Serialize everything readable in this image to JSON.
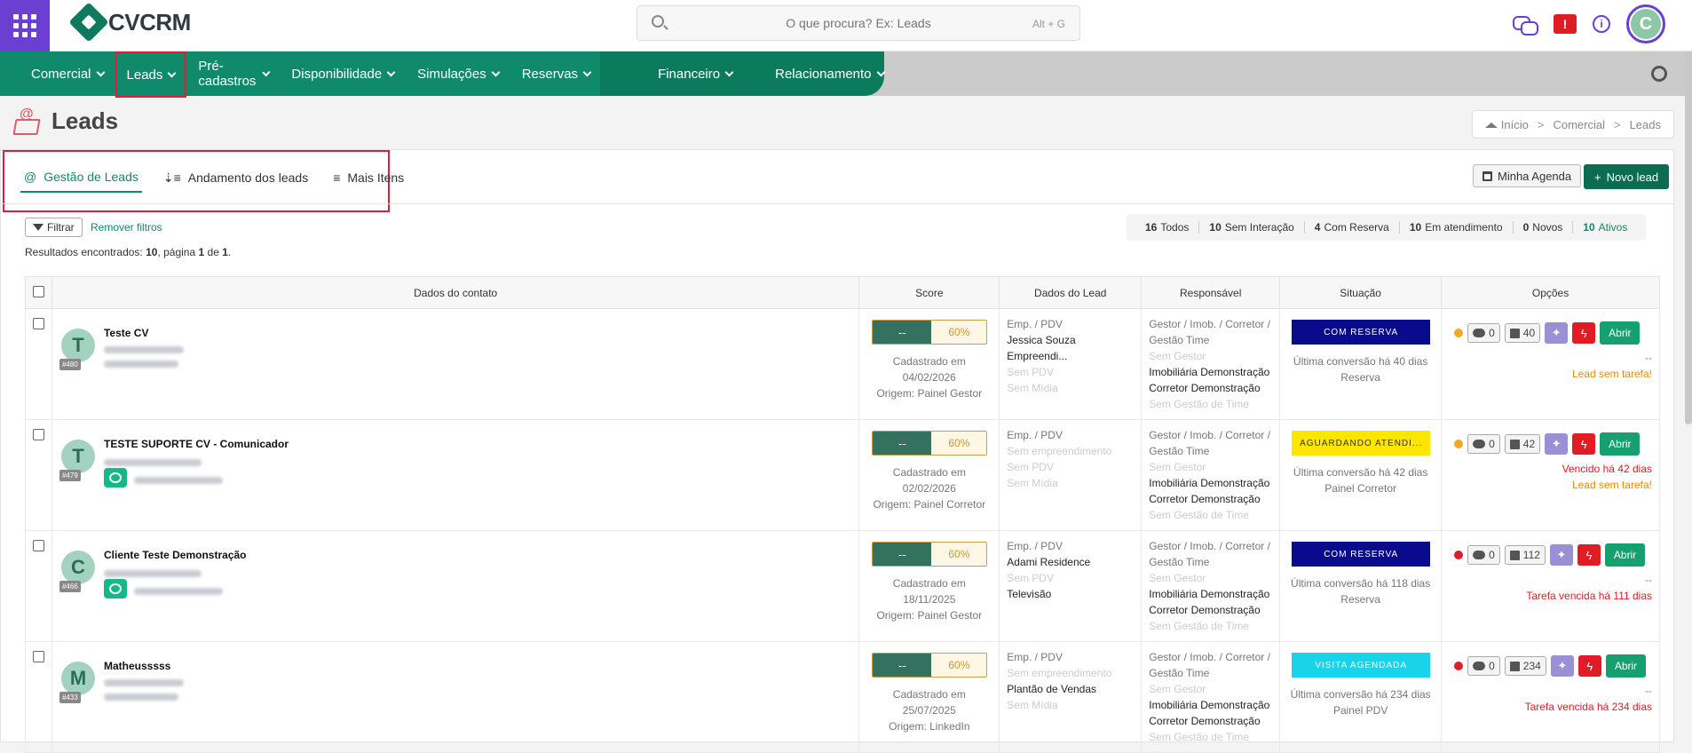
{
  "app": {
    "brand": "CVCRM"
  },
  "search": {
    "placeholder": "O que procura? Ex: Leads",
    "shortcut": "Alt + G"
  },
  "topbar": {
    "alert_glyph": "!",
    "info_glyph": "i",
    "user_initial": "C"
  },
  "nav": {
    "items": [
      "Comercial",
      "Leads",
      "Pré-cadastros",
      "Disponibilidade",
      "Simulações",
      "Reservas",
      "Financeiro",
      "Relacionamento"
    ]
  },
  "page": {
    "title": "Leads"
  },
  "breadcrumb": {
    "items": [
      "Início",
      "Comercial",
      "Leads"
    ],
    "sep": ">"
  },
  "tabs": {
    "items": [
      "Gestão de Leads",
      "Andamento dos leads",
      "Mais Itens"
    ]
  },
  "toolbar": {
    "agenda": "Minha Agenda",
    "novo": "Novo lead",
    "filtrar": "Filtrar",
    "remover": "Remover filtros"
  },
  "results": {
    "label": "Resultados encontrados:",
    "count": "10",
    "page_label": ", página",
    "page": "1",
    "of_label": "de",
    "total_pages": "1",
    "end": "."
  },
  "counters": [
    {
      "n": "16",
      "label": "Todos"
    },
    {
      "n": "10",
      "label": "Sem Interação"
    },
    {
      "n": "4",
      "label": "Com Reserva"
    },
    {
      "n": "10",
      "label": "Em atendimento"
    },
    {
      "n": "0",
      "label": "Novos"
    },
    {
      "n": "10",
      "label": "Ativos"
    }
  ],
  "table": {
    "headers": [
      "Dados do contato",
      "Score",
      "Dados do Lead",
      "Responsável",
      "Situação",
      "Opções"
    ],
    "abrir": "Abrir",
    "score_dash": "--",
    "rows": [
      {
        "initial": "T",
        "id": "#480",
        "name": "Teste CV",
        "chat": false,
        "score_pct": "60%",
        "score_value": 0.6,
        "cadastrado_label": "Cadastrado em",
        "cadastrado": "04/02/2026",
        "origem": "Origem: Painel Gestor",
        "lead": [
          "Emp. / PDV",
          "Jessica Souza Empreendi...",
          "Sem PDV",
          "Sem Mídia"
        ],
        "lead_style": [
          "gray",
          "dark",
          "faint",
          "faint"
        ],
        "resp": [
          "Gestor / Imob. / Corretor /",
          "Gestão Time",
          "Sem Gestor",
          "Imobiliária Demonstração",
          "Corretor Demonstração",
          "Sem Gestão de Time"
        ],
        "sit": "COM RESERVA",
        "sit_bg": "#0a0a8c",
        "sit_fg": "#ffffff",
        "sit_info": [
          "Última conversão há 40 dias",
          "Reserva"
        ],
        "dot": "#f5a623",
        "chats": "0",
        "tasks": "40",
        "notes": [
          "--",
          "Lead sem tarefa!"
        ],
        "notes_style": [
          "gray",
          "orange"
        ]
      },
      {
        "initial": "T",
        "id": "#479",
        "name": "TESTE SUPORTE CV - Comunicador",
        "chat": true,
        "score_pct": "60%",
        "score_value": 0.6,
        "cadastrado_label": "Cadastrado em",
        "cadastrado": "02/02/2026",
        "origem": "Origem: Painel Corretor",
        "lead": [
          "Emp. / PDV",
          "Sem empreendimento",
          "Sem PDV",
          "Sem Mídia"
        ],
        "lead_style": [
          "gray",
          "faint",
          "faint",
          "faint"
        ],
        "resp": [
          "Gestor / Imob. / Corretor /",
          "Gestão Time",
          "Sem Gestor",
          "Imobiliária Demonstração",
          "Corretor Demonstração",
          "Sem Gestão de Time"
        ],
        "sit": "AGUARDANDO ATENDI...",
        "sit_bg": "#ffe600",
        "sit_fg": "#333333",
        "sit_info": [
          "Última conversão há 42 dias",
          "Painel Corretor"
        ],
        "dot": "#f5a623",
        "chats": "0",
        "tasks": "42",
        "notes": [
          "Vencido há 42 dias",
          "Lead sem tarefa!"
        ],
        "notes_style": [
          "red",
          "orange"
        ]
      },
      {
        "initial": "C",
        "id": "#466",
        "name": "Cliente Teste Demonstração",
        "chat": true,
        "score_pct": "60%",
        "score_value": 0.6,
        "cadastrado_label": "Cadastrado em",
        "cadastrado": "18/11/2025",
        "origem": "Origem: Painel Gestor",
        "lead": [
          "Emp. / PDV",
          "Adami Residence",
          "Sem PDV",
          "Televisão"
        ],
        "lead_style": [
          "gray",
          "dark",
          "faint",
          "dark"
        ],
        "resp": [
          "Gestor / Imob. / Corretor /",
          "Gestão Time",
          "Sem Gestor",
          "Imobiliária Demonstração",
          "Corretor Demonstração",
          "Sem Gestão de Time"
        ],
        "sit": "COM RESERVA",
        "sit_bg": "#0a0a8c",
        "sit_fg": "#ffffff",
        "sit_info": [
          "Última conversão há 118 dias",
          "Reserva"
        ],
        "dot": "#e01c24",
        "chats": "0",
        "tasks": "112",
        "notes": [
          "--",
          "Tarefa vencida há 111 dias"
        ],
        "notes_style": [
          "gray",
          "red"
        ]
      },
      {
        "initial": "M",
        "id": "#433",
        "name": "Matheusssss",
        "chat": false,
        "score_pct": "60%",
        "score_value": 0.6,
        "cadastrado_label": "Cadastrado em",
        "cadastrado": "25/07/2025",
        "origem": "Origem: LinkedIn",
        "lead": [
          "Emp. / PDV",
          "Sem empreendimento",
          "Plantão de Vendas",
          "Sem Mídia"
        ],
        "lead_style": [
          "gray",
          "faint",
          "dark",
          "faint"
        ],
        "resp": [
          "Gestor / Imob. / Corretor /",
          "Gestão Time",
          "Sem Gestor",
          "Imobiliária Demonstração",
          "Corretor Demonstração",
          "Sem Gestão de Time"
        ],
        "sit": "VISITA AGENDADA",
        "sit_bg": "#19d3ea",
        "sit_fg": "#ffffff",
        "sit_info": [
          "Última conversão há 234 dias",
          "Painel PDV"
        ],
        "dot": "#e01c24",
        "chats": "0",
        "tasks": "234",
        "notes": [
          "--",
          "Tarefa vencida há 234 dias"
        ],
        "notes_style": [
          "gray",
          "red"
        ]
      }
    ]
  }
}
